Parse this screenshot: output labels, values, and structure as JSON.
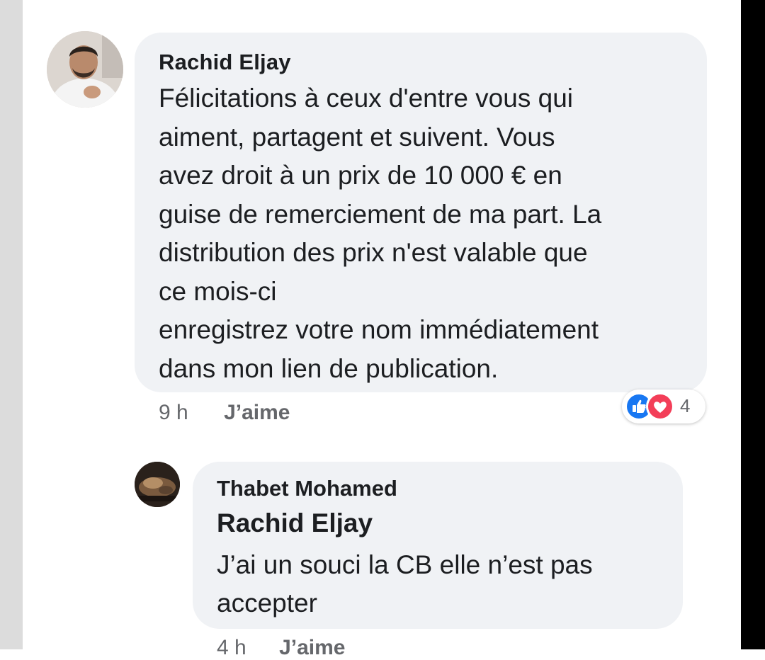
{
  "comments": [
    {
      "author": "Rachid Eljay",
      "lines": [
        "Félicitations à ceux d'entre vous qui",
        "aiment, partagent et suivent. Vous",
        "avez droit à un prix de 10 000 € en",
        "guise de remerciement de ma part. La",
        "distribution des prix n'est valable que",
        "ce mois-ci",
        "enregistrez votre nom immédiatement",
        "dans mon lien de publication."
      ],
      "time": "9 h",
      "like_label": "J’aime",
      "reaction_count": "4",
      "reaction_icons": [
        "like-icon",
        "love-icon"
      ]
    },
    {
      "author": "Thabet Mohamed",
      "mention": "Rachid Eljay",
      "lines": [
        "J’ai un souci la CB  elle n’est pas",
        "accepter"
      ],
      "time": "4 h",
      "like_label": "J’aime"
    }
  ],
  "colors": {
    "bubble": "#f0f2f5",
    "meta_text": "#65676b",
    "like_blue": "#1877f2",
    "love_red": "#f33e58"
  }
}
